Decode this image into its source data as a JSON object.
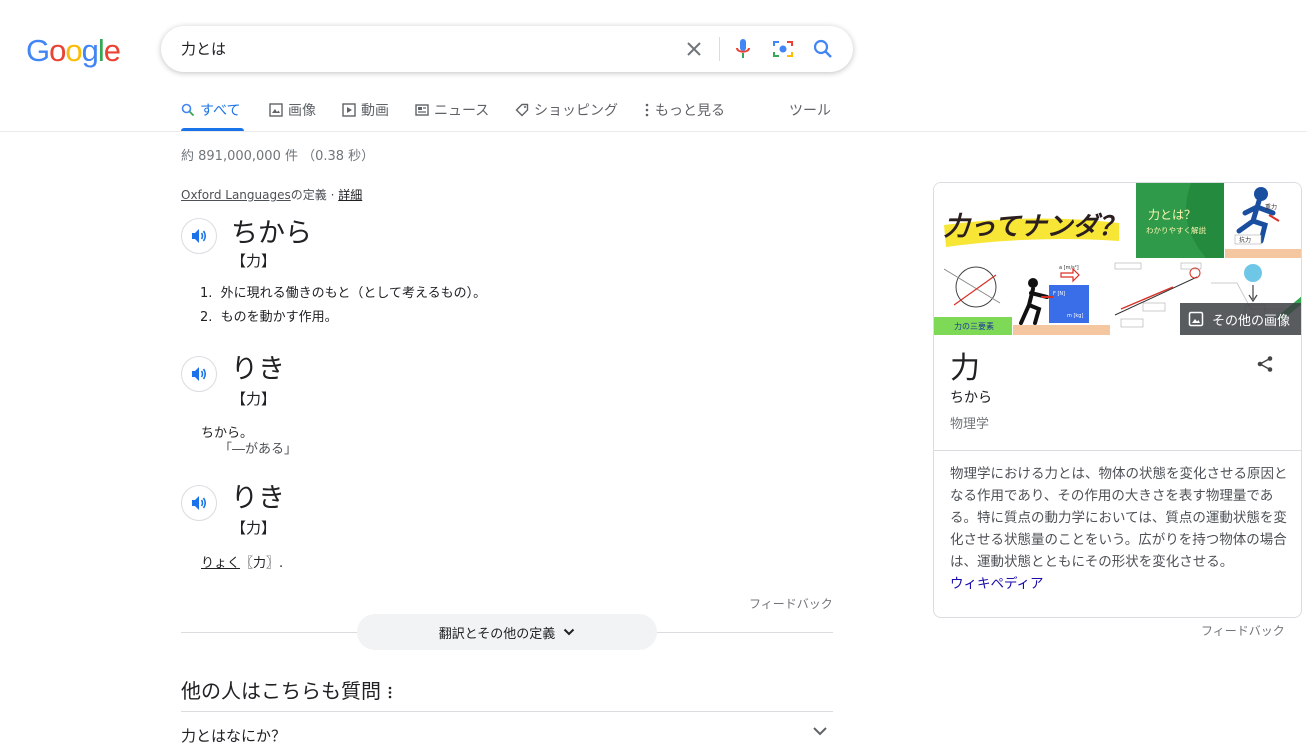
{
  "logo": {
    "letters": [
      "G",
      "o",
      "o",
      "g",
      "l",
      "e"
    ],
    "colors": [
      "#4285F4",
      "#EA4335",
      "#FBBC05",
      "#4285F4",
      "#34A853",
      "#EA4335"
    ]
  },
  "search": {
    "query": "力とは"
  },
  "tabs": [
    {
      "label": "すべて",
      "icon": "search-icon"
    },
    {
      "label": "画像",
      "icon": "image-icon"
    },
    {
      "label": "動画",
      "icon": "video-icon"
    },
    {
      "label": "ニュース",
      "icon": "news-icon"
    },
    {
      "label": "ショッピング",
      "icon": "tag-icon"
    },
    {
      "label": "もっと見る",
      "icon": "more-vert-icon"
    }
  ],
  "tools_label": "ツール",
  "stats": "約 891,000,000 件 （0.38 秒）",
  "dictionary": {
    "source_link": "Oxford Languages",
    "source_suffix": "の定義",
    "separator": " · ",
    "detail_link": "詳細",
    "entries": [
      {
        "word": "ちから",
        "kanji": "【力】",
        "defs": [
          "外に現れる働きのもと（として考えるもの）。",
          "ものを動かす作用。"
        ]
      },
      {
        "word": "りき",
        "kanji": "【力】",
        "text": "ちから。",
        "example": "「―がある」"
      },
      {
        "word": "りき",
        "kanji": "【力】",
        "link": "りょく",
        "tail": "〖力〗."
      }
    ],
    "feedback": "フィードバック",
    "more_button": "翻訳とその他の定義"
  },
  "paa": {
    "title": "他の人はこちらも質問",
    "questions": [
      "力とはなにか？"
    ]
  },
  "knowledge_panel": {
    "title": "力",
    "reading": "ちから",
    "category": "物理学",
    "description": "物理学における力とは、物体の状態を変化させる原因となる作用であり、その作用の大きさを表す物理量である。特に質点の動力学においては、質点の運動状態を変化させる状態量のことをいう。広がりを持つ物体の場合は、運動状態とともにその形状を変化させる。",
    "source": "ウィキペディア",
    "more_images": "その他の画像",
    "images": {
      "img1_text": "力ってナンダ？",
      "img2_title": "力とは？",
      "img2_sub": "わかりやすく解説",
      "img3_labels": [
        "重力",
        "抗力"
      ],
      "img4_label": "力の三要素",
      "img5_labels": [
        "a [m/s²]",
        "F [N]",
        "m [kg]"
      ]
    },
    "feedback": "フィードバック"
  }
}
